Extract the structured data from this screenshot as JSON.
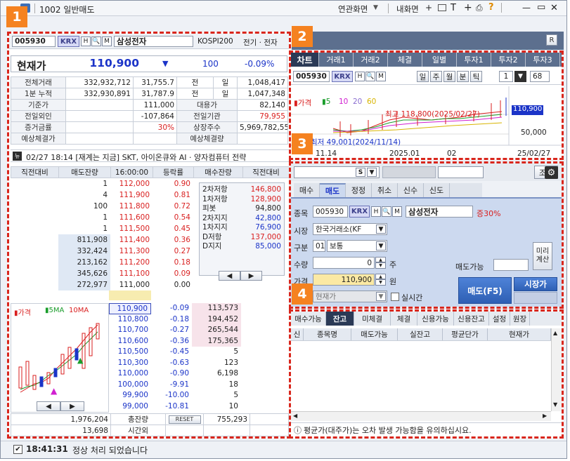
{
  "window": {
    "title": "1002 일반매도",
    "menu_link": "연관화면",
    "menu_my": "내화면",
    "win_min": "—",
    "win_max": "▭",
    "win_close": "✕"
  },
  "badges": [
    "1",
    "2",
    "3",
    "4"
  ],
  "header": {
    "code": "005930",
    "market": "KRX",
    "b1": "H",
    "b2": "🔍",
    "b3": "M",
    "name": "삼성전자",
    "index": "KOSPI200",
    "sector": "전기 · 전자"
  },
  "price": {
    "label": "현재가",
    "value": "110,900",
    "arrow": "▼",
    "change": "100",
    "rate": "-0.09%"
  },
  "summary": [
    [
      "전체거래",
      "332,932,712",
      "31,755.7",
      "전",
      "일",
      "1,048,417"
    ],
    [
      "1분 누적",
      "332,930,891",
      "31,787.9",
      "전",
      "일",
      "1,047,348"
    ],
    [
      "기준가",
      "",
      "111,000",
      "대용가",
      "",
      "82,140"
    ],
    [
      "전일외인",
      "",
      "-107,864",
      "전일기관",
      "",
      "79,955"
    ],
    [
      "증거금률",
      "",
      "30%",
      "상장주수",
      "",
      "5,969,782,550"
    ],
    [
      "예상체결가",
      "",
      "",
      "예상체결량",
      "",
      ""
    ]
  ],
  "news": "02/27 18:14 [재계는 지금] SKT, 아이온큐와 AI · 양자컴퓨터 전략",
  "orderbook": {
    "headers": [
      "직전대비",
      "매도잔량",
      "16:00:00",
      "등락률",
      "매수잔량",
      "직전대비"
    ],
    "asks": [
      [
        "",
        "1",
        "112,000",
        "0.90"
      ],
      [
        "",
        "4",
        "111,900",
        "0.81"
      ],
      [
        "",
        "100",
        "111,800",
        "0.72"
      ],
      [
        "",
        "1",
        "111,600",
        "0.54"
      ],
      [
        "",
        "1",
        "111,500",
        "0.45"
      ],
      [
        "",
        "811,908",
        "111,400",
        "0.36"
      ],
      [
        "",
        "332,424",
        "111,300",
        "0.27"
      ],
      [
        "",
        "213,162",
        "111,200",
        "0.18"
      ],
      [
        "",
        "345,626",
        "111,100",
        "0.09"
      ],
      [
        "",
        "272,977",
        "111,000",
        "0.00"
      ]
    ],
    "bids": [
      [
        "110,900",
        "-0.09",
        "113,573"
      ],
      [
        "110,800",
        "-0.18",
        "194,452"
      ],
      [
        "110,700",
        "-0.27",
        "265,544"
      ],
      [
        "110,600",
        "-0.36",
        "175,365"
      ],
      [
        "110,500",
        "-0.45",
        "5"
      ],
      [
        "110,300",
        "-0.63",
        "123"
      ],
      [
        "110,000",
        "-0.90",
        "6,198"
      ],
      [
        "100,000",
        "-9.91",
        "18"
      ],
      [
        "99,900",
        "-10.00",
        "5"
      ],
      [
        "99,000",
        "-10.81",
        "10"
      ]
    ],
    "pivots": [
      [
        "2차저항",
        "146,800"
      ],
      [
        "1차저항",
        "128,900"
      ],
      [
        "피봇",
        "94,800"
      ],
      [
        "2차지지",
        "42,800"
      ],
      [
        "1차지지",
        "76,900"
      ],
      [
        "D저항",
        "137,000"
      ],
      [
        "D지지",
        "85,000"
      ]
    ],
    "totals": {
      "ask_total": "1,976,204",
      "total_label": "총잔량",
      "reset": "RESET",
      "bid_total": "755,293",
      "after_qty": "13,698",
      "after_label": "시간외"
    },
    "minichart": {
      "title": "가격",
      "ma1": "5MA",
      "ma2": "10MA"
    }
  },
  "chart": {
    "tabs": [
      "차트",
      "거래1",
      "거래2",
      "체결",
      "일별",
      "투자1",
      "투자2",
      "투자3"
    ],
    "code": "005930",
    "market": "KRX",
    "period_buttons": [
      "일",
      "주",
      "월",
      "분",
      "틱"
    ],
    "interval": "1",
    "count": "68",
    "legend": {
      "title": "가격",
      "ma5": "5",
      "ma10": "10",
      "ma20": "20",
      "ma60": "60"
    },
    "high_label": "최고 118,800(2025/02/27)",
    "low_label": "최저 49,001(2024/11/14)",
    "last_price": "110,900",
    "axis_mid": "50,000",
    "xticks": [
      "11.14",
      "2025.01",
      "02",
      "25/02/27"
    ]
  },
  "order": {
    "lookup": "조회",
    "tabs": [
      "매수",
      "매도",
      "정정",
      "취소",
      "신수",
      "신도"
    ],
    "code_label": "종목",
    "code": "005930",
    "market": "KRX",
    "name": "삼성전자",
    "margin": "증30%",
    "market_label": "시장",
    "market_value": "한국거래소(KF",
    "type_label": "구분",
    "type_num": "01",
    "type_value": "보통",
    "qty_label": "수량",
    "qty_value": "0",
    "qty_unit": "주",
    "price_label": "가격",
    "price_value": "110,900",
    "price_unit": "원",
    "price_type": "현재가",
    "realtime": "실시간",
    "avail_label": "매도가능",
    "calc_btn": "미리계산",
    "sell_btn": "매도(F5)",
    "market_btn": "시장가"
  },
  "balance": {
    "tabs": [
      "매수가능",
      "잔고",
      "미체결",
      "체결",
      "신용가능",
      "신용잔고",
      "설정",
      "원장"
    ],
    "headers": [
      "신",
      "종목명",
      "매도가능",
      "실잔고",
      "평균단가",
      "현재가"
    ],
    "notice": "평균가(대주가)는 오차 발생 가능함을 유의하십시요."
  },
  "status": {
    "time": "18:41:31",
    "message": "정상 처리 되었습니다"
  },
  "colors": {
    "badge": "#f58220",
    "dash": "#d9261c",
    "up": "#d91f1f",
    "down": "#1b34c8"
  }
}
